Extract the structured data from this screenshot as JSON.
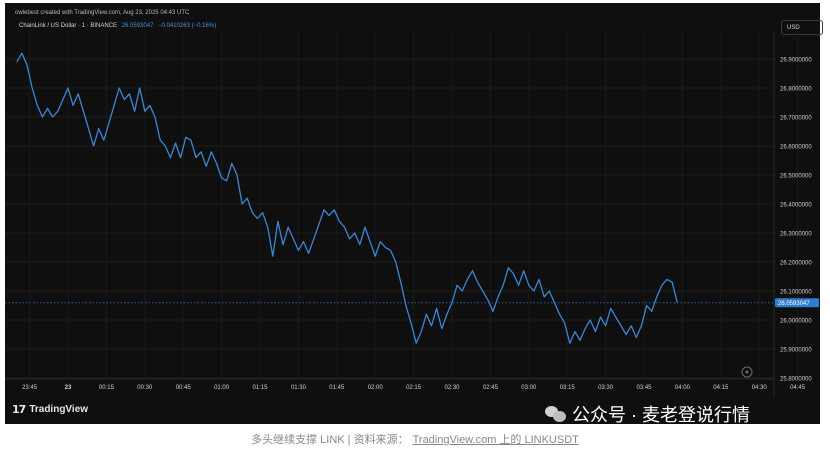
{
  "header": {
    "credit": "owlebest created with TradingView.com, Aug 23, 2025 04:43 UTC",
    "symbol": "ChainLink / US Dollar · 1 · BINANCE",
    "last_value": "26.0593047",
    "change": "−0.0410263 (−0.16%)",
    "currency": "USD"
  },
  "colors": {
    "line": "#3d86d4",
    "background": "#0f0f0f",
    "axis_text": "#d0d0d0",
    "price_tag": "#2f7dd1"
  },
  "branding": {
    "logo_mark": "17",
    "logo_text": "TradingView",
    "watermark_icon": "wechat-icon",
    "watermark": "公众号 · 麦老登说行情"
  },
  "caption": {
    "text": "多头继续支撑 LINK | 资料来源：",
    "link": "TradingView.com 上的 LINKUSDT"
  },
  "chart_data": {
    "type": "line",
    "title": "ChainLink / US Dollar · 1 · BINANCE",
    "x_tick_labels": [
      "23:45",
      "23",
      "00:15",
      "00:30",
      "00:45",
      "01:00",
      "01:15",
      "01:30",
      "01:45",
      "02:00",
      "02:15",
      "02:30",
      "02:45",
      "03:00",
      "03:15",
      "03:30",
      "03:45",
      "04:00",
      "04:15",
      "04:30",
      "04:45"
    ],
    "y_tick_labels": [
      "26.9000000",
      "26.8000000",
      "26.7000000",
      "26.6000000",
      "26.5000000",
      "26.4000000",
      "26.3000000",
      "26.2000000",
      "26.1000000",
      "26.0000000",
      "25.9000000",
      "25.8000000"
    ],
    "ylim": [
      25.8,
      26.9
    ],
    "xlim_minutes": [
      -20,
      325
    ],
    "current_price": 26.0593047,
    "series": [
      {
        "x_minutes": [
          -20,
          -18,
          -16,
          -14,
          -12,
          -10,
          -8,
          -6,
          -4,
          -2,
          0,
          2,
          4,
          6,
          8,
          10,
          12,
          14,
          16,
          18,
          20,
          22,
          24,
          26,
          28,
          30,
          32,
          34,
          36,
          38,
          40,
          42,
          44,
          46,
          48,
          50,
          52,
          54,
          56,
          58,
          60,
          62,
          64,
          66,
          68,
          70,
          72,
          74,
          76,
          78,
          80,
          82,
          84,
          86,
          88,
          90,
          92,
          94,
          96,
          98,
          100,
          102,
          104,
          106,
          108,
          110,
          112,
          114,
          116,
          118,
          120,
          122,
          124,
          126,
          128,
          130,
          132,
          134,
          136,
          138,
          140,
          142,
          144,
          146,
          148,
          150,
          152,
          154,
          156,
          158,
          160,
          162,
          164,
          166,
          168,
          170,
          172,
          174,
          176,
          178,
          180,
          182,
          184,
          186,
          188,
          190,
          192,
          194,
          196,
          198,
          200,
          202,
          204,
          206,
          208,
          210,
          212,
          214,
          216,
          218,
          220,
          222,
          224,
          226,
          228,
          230,
          232,
          234,
          236,
          238,
          240,
          242,
          244,
          246,
          248,
          250,
          252,
          254,
          256,
          258,
          260,
          262,
          264,
          266,
          268,
          270,
          272,
          274,
          276,
          278,
          280,
          282,
          284,
          286,
          288,
          290,
          292,
          294,
          296,
          298,
          300,
          302,
          304,
          306,
          308,
          310,
          312
        ],
        "values": [
          26.89,
          26.92,
          26.88,
          26.8,
          26.74,
          26.7,
          26.73,
          26.7,
          26.72,
          26.76,
          26.8,
          26.74,
          26.78,
          26.72,
          26.66,
          26.6,
          26.66,
          26.62,
          26.68,
          26.74,
          26.8,
          26.76,
          26.78,
          26.72,
          26.8,
          26.72,
          26.74,
          26.7,
          26.62,
          26.6,
          26.56,
          26.61,
          26.56,
          26.63,
          26.62,
          26.56,
          26.58,
          26.53,
          26.58,
          26.54,
          26.49,
          26.48,
          26.54,
          26.5,
          26.4,
          26.42,
          26.37,
          26.35,
          26.37,
          26.32,
          26.22,
          26.34,
          26.26,
          26.32,
          26.28,
          26.24,
          26.27,
          26.23,
          26.28,
          26.33,
          26.38,
          26.36,
          26.38,
          26.34,
          26.32,
          26.28,
          26.3,
          26.26,
          26.32,
          26.27,
          26.22,
          26.27,
          26.25,
          26.24,
          26.2,
          26.13,
          26.05,
          25.99,
          25.92,
          25.96,
          26.02,
          25.98,
          26.04,
          25.97,
          26.02,
          26.06,
          26.12,
          26.1,
          26.14,
          26.17,
          26.13,
          26.1,
          26.07,
          26.03,
          26.08,
          26.12,
          26.18,
          26.16,
          26.12,
          26.17,
          26.12,
          26.1,
          26.14,
          26.08,
          26.1,
          26.06,
          26.02,
          25.99,
          25.92,
          25.96,
          25.93,
          25.97,
          26.0,
          25.96,
          26.01,
          25.98,
          26.04,
          26.01,
          25.98,
          25.95,
          25.98,
          25.94,
          25.98,
          26.05,
          26.03,
          26.08,
          26.12,
          26.14,
          26.13,
          26.06
        ]
      }
    ]
  }
}
